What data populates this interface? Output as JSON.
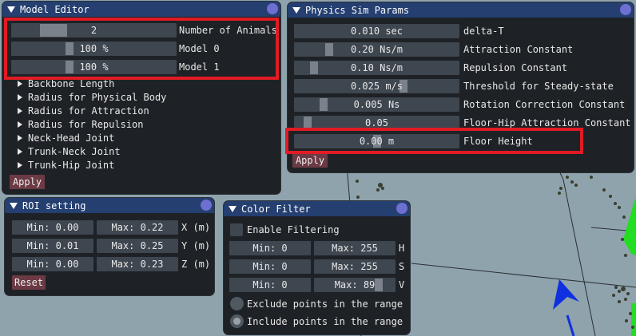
{
  "colors": {
    "background": "#8fa3ad",
    "title_bar": "#243f70",
    "panel": "#1e2226",
    "field": "#3e464f",
    "button": "#6b3a44",
    "highlight": "#e01b24",
    "axis_blue": "#1030e0",
    "axis_green": "#22dd22"
  },
  "model_editor": {
    "title": "Model Editor",
    "sliders": [
      {
        "value": "2",
        "label": "Number of Animals"
      },
      {
        "value": "100 %",
        "label": "Model 0"
      },
      {
        "value": "100 %",
        "label": "Model 1"
      }
    ],
    "tree_items": [
      "Backbone Length",
      "Radius for Physical Body",
      "Radius for Attraction",
      "Radius for Repulsion",
      "Neck-Head Joint",
      "Trunk-Neck Joint",
      "Trunk-Hip Joint"
    ],
    "apply": "Apply"
  },
  "physics": {
    "title": "Physics Sim Params",
    "params": [
      {
        "value": "0.010 sec",
        "label": "delta-T"
      },
      {
        "value": "0.20 Ns/m",
        "label": "Attraction Constant"
      },
      {
        "value": "0.10 Ns/m",
        "label": "Repulsion Constant"
      },
      {
        "value": "0.025 m/s",
        "label": "Threshold for Steady-state"
      },
      {
        "value": "0.005 Ns",
        "label": "Rotation Correction Constant"
      },
      {
        "value": "0.05",
        "label": "Floor-Hip Attraction Constant"
      },
      {
        "value": "0.00 m",
        "label": "Floor Height"
      }
    ],
    "apply": "Apply"
  },
  "roi": {
    "title": "ROI setting",
    "rows": [
      {
        "min": "Min: 0.00",
        "max": "Max: 0.22",
        "axis": "X (m)"
      },
      {
        "min": "Min: 0.01",
        "max": "Max: 0.25",
        "axis": "Y (m)"
      },
      {
        "min": "Min: 0.00",
        "max": "Max: 0.23",
        "axis": "Z (m)"
      }
    ],
    "reset": "Reset"
  },
  "color_filter": {
    "title": "Color Filter",
    "enable": "Enable Filtering",
    "rows": [
      {
        "min": "Min: 0",
        "max": "Max: 255",
        "ch": "H"
      },
      {
        "min": "Min: 0",
        "max": "Max: 255",
        "ch": "S"
      },
      {
        "min": "Min: 0",
        "max": "Max: 89",
        "ch": "V"
      }
    ],
    "exclude": "Exclude points in the range",
    "include": "Include points in the range"
  }
}
